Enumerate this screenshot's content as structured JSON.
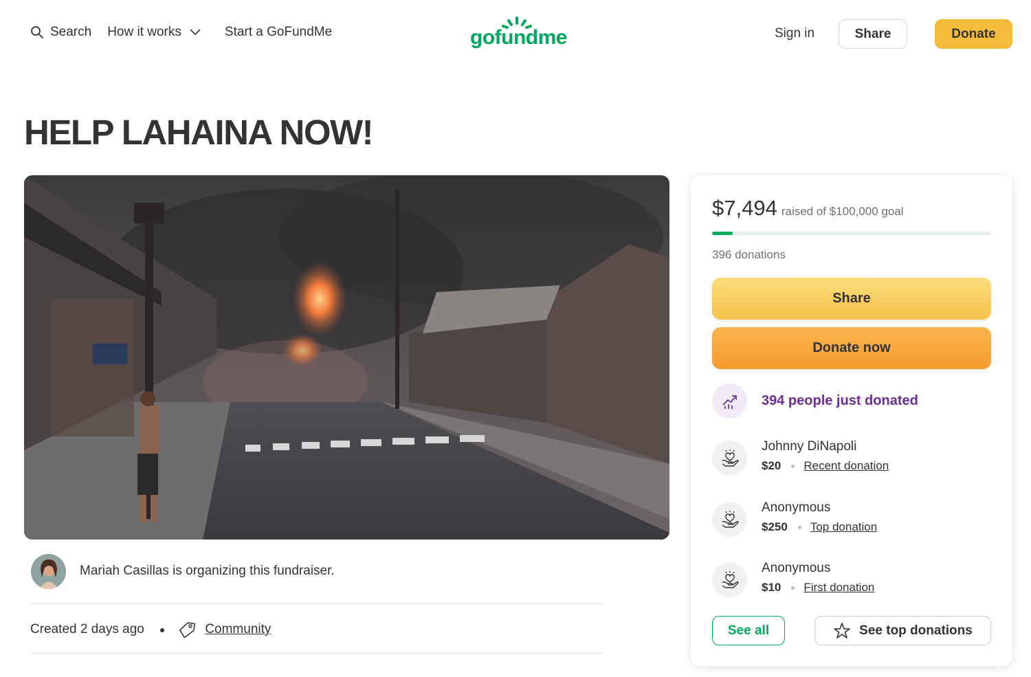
{
  "header": {
    "search_label": "Search",
    "how_it_works_label": "How it works",
    "start_label": "Start a GoFundMe",
    "logo_text": "gofundme",
    "sign_in_label": "Sign in",
    "share_label": "Share",
    "donate_label": "Donate"
  },
  "page": {
    "title": "HELP LAHAINA NOW!"
  },
  "organizer": {
    "text": "Mariah Casillas is organizing this fundraiser.",
    "created": "Created 2 days ago",
    "category": "Community"
  },
  "sidebar": {
    "raised_amount": "$7,494",
    "goal_text": "raised of $100,000 goal",
    "progress_fraction": 0.075,
    "donations_count": "396 donations",
    "share_button": "Share",
    "donate_button": "Donate now",
    "recent_activity": "394 people just donated",
    "donors": [
      {
        "name": "Johnny DiNapoli",
        "amount": "$20",
        "kind": "Recent donation"
      },
      {
        "name": "Anonymous",
        "amount": "$250",
        "kind": "Top donation"
      },
      {
        "name": "Anonymous",
        "amount": "$10",
        "kind": "First donation"
      }
    ],
    "see_all_button": "See all",
    "see_top_button": "See top donations"
  },
  "colors": {
    "brand_green": "#02a95c",
    "donate_yellow": "#f6bb3b",
    "donate_orange": "#f5a033",
    "activity_purple": "#6b2e96"
  },
  "icons": [
    "search-icon",
    "chevron-down-icon",
    "trend-up-icon",
    "donor-heart-icon",
    "tag-icon",
    "star-icon"
  ]
}
